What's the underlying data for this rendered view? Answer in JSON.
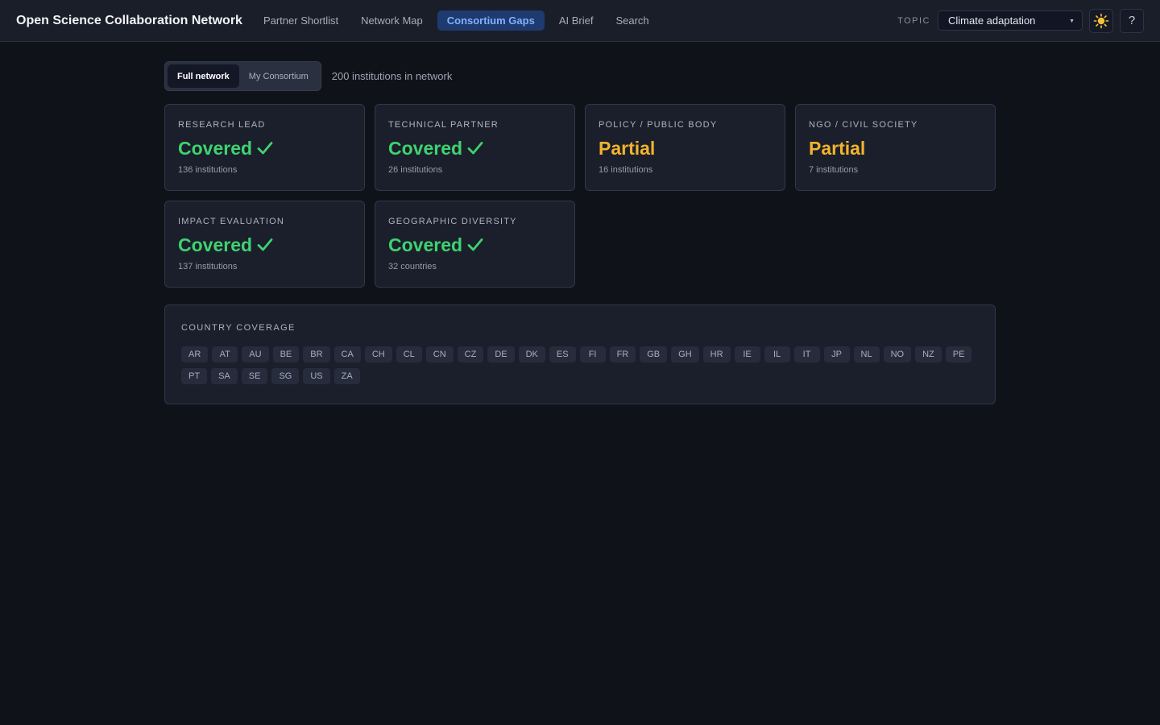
{
  "app": {
    "title": "Open Science Collaboration Network"
  },
  "nav": {
    "items": [
      {
        "label": "Partner Shortlist",
        "active": false
      },
      {
        "label": "Network Map",
        "active": false
      },
      {
        "label": "Consortium Gaps",
        "active": true
      },
      {
        "label": "AI Brief",
        "active": false
      },
      {
        "label": "Search",
        "active": false
      }
    ]
  },
  "topic": {
    "label": "TOPIC",
    "selected": "Climate adaptation"
  },
  "icons": {
    "theme": "sun-icon",
    "help": "help-icon",
    "help_glyph": "?"
  },
  "view_toggle": {
    "options": [
      "Full network",
      "My Consortium"
    ],
    "selected": "Full network"
  },
  "summary": {
    "count_text": "200 institutions in network"
  },
  "colors": {
    "covered": "#3ed36f",
    "partial": "#f2b32c",
    "accent": "#7fb1ff"
  },
  "cards": [
    {
      "title": "RESEARCH LEAD",
      "status": "Covered",
      "state": "covered",
      "detail": "136 institutions"
    },
    {
      "title": "TECHNICAL PARTNER",
      "status": "Covered",
      "state": "covered",
      "detail": "26 institutions"
    },
    {
      "title": "POLICY / PUBLIC BODY",
      "status": "Partial",
      "state": "partial",
      "detail": "16 institutions"
    },
    {
      "title": "NGO / CIVIL SOCIETY",
      "status": "Partial",
      "state": "partial",
      "detail": "7 institutions"
    },
    {
      "title": "IMPACT EVALUATION",
      "status": "Covered",
      "state": "covered",
      "detail": "137 institutions"
    },
    {
      "title": "GEOGRAPHIC DIVERSITY",
      "status": "Covered",
      "state": "covered",
      "detail": "32 countries"
    }
  ],
  "country_coverage": {
    "title": "COUNTRY COVERAGE",
    "countries": [
      "AR",
      "AT",
      "AU",
      "BE",
      "BR",
      "CA",
      "CH",
      "CL",
      "CN",
      "CZ",
      "DE",
      "DK",
      "ES",
      "FI",
      "FR",
      "GB",
      "GH",
      "HR",
      "IE",
      "IL",
      "IT",
      "JP",
      "NL",
      "NO",
      "NZ",
      "PE",
      "PT",
      "SA",
      "SE",
      "SG",
      "US",
      "ZA"
    ]
  }
}
